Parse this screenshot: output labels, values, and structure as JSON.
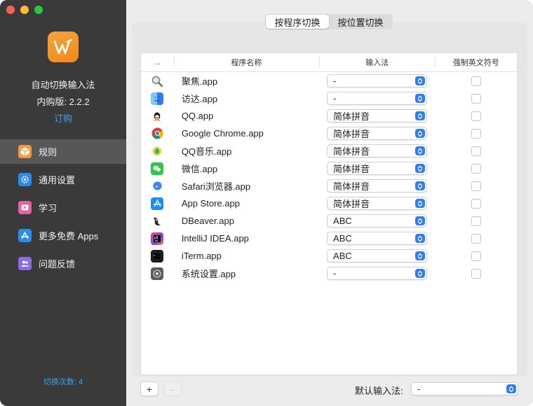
{
  "window_controls": [
    "close",
    "minimize",
    "maximize"
  ],
  "sidebar": {
    "app_name": "自动切换输入法",
    "version": "内购版: 2.2.2",
    "subscribe_label": "订购",
    "items": [
      {
        "label": "规则",
        "icon": "box-icon",
        "color": "#f39a3e",
        "active": true
      },
      {
        "label": "通用设置",
        "icon": "gear-icon",
        "color": "#2b8cf0",
        "active": false
      },
      {
        "label": "学习",
        "icon": "play-icon",
        "color": "#ef5da8",
        "active": false
      },
      {
        "label": "更多免费 Apps",
        "icon": "app-store-icon",
        "color": "#2b8cf0",
        "active": false
      },
      {
        "label": "问题反馈",
        "icon": "people-icon",
        "color": "#8f6ae8",
        "active": false
      }
    ],
    "switch_count": "切换次数: 4"
  },
  "segmented": {
    "options": [
      "按程序切换",
      "按位置切换"
    ],
    "selected": 0
  },
  "table": {
    "headers": [
      "...",
      "程序名称",
      "输入法",
      "强制英文符号"
    ],
    "rows": [
      {
        "icon": "spotlight-icon",
        "name": "聚焦.app",
        "ime": "-",
        "force_english": false
      },
      {
        "icon": "finder-icon",
        "name": "访达.app",
        "ime": "-",
        "force_english": false
      },
      {
        "icon": "qq-icon",
        "name": "QQ.app",
        "ime": "简体拼音",
        "force_english": false
      },
      {
        "icon": "chrome-icon",
        "name": "Google Chrome.app",
        "ime": "简体拼音",
        "force_english": false
      },
      {
        "icon": "qq-music-icon",
        "name": "QQ音乐.app",
        "ime": "简体拼音",
        "force_english": false
      },
      {
        "icon": "wechat-icon",
        "name": "微信.app",
        "ime": "简体拼音",
        "force_english": false
      },
      {
        "icon": "safari-icon",
        "name": "Safari浏览器.app",
        "ime": "简体拼音",
        "force_english": false
      },
      {
        "icon": "app-store-icon",
        "name": "App Store.app",
        "ime": "简体拼音",
        "force_english": false
      },
      {
        "icon": "dbeaver-icon",
        "name": "DBeaver.app",
        "ime": "ABC",
        "force_english": false
      },
      {
        "icon": "intellij-icon",
        "name": "IntelliJ IDEA.app",
        "ime": "ABC",
        "force_english": false
      },
      {
        "icon": "iterm-icon",
        "name": "iTerm.app",
        "ime": "ABC",
        "force_english": false
      },
      {
        "icon": "system-settings-icon",
        "name": "系统设置.app",
        "ime": "-",
        "force_english": false
      }
    ]
  },
  "footer": {
    "add_label": "+",
    "remove_label": "-",
    "remove_enabled": false,
    "default_ime_label": "默认输入法:",
    "default_ime_value": "-"
  },
  "colors": {
    "accent": "#2f7cf6",
    "link": "#3ca4e8",
    "sidebar_bg": "#3a3a3a"
  }
}
